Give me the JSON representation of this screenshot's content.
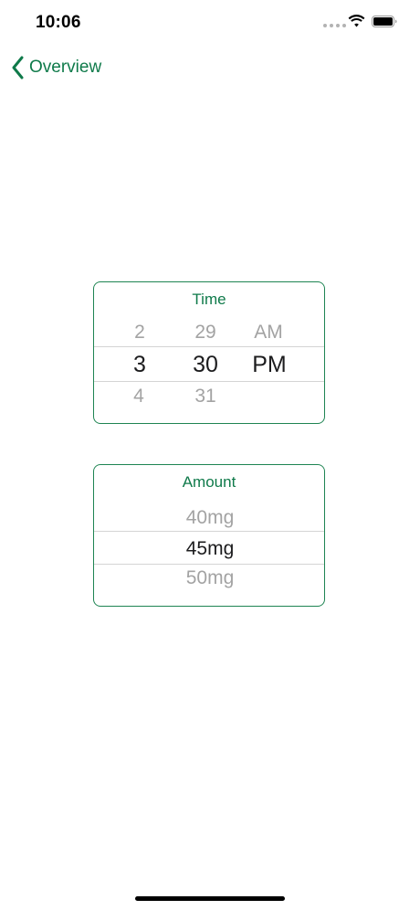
{
  "status_bar": {
    "time": "10:06"
  },
  "nav": {
    "back_label": "Overview",
    "back_icon": "chevron-left-icon"
  },
  "colors": {
    "accent": "#0f7a4a",
    "card_border": "#1e8452",
    "dimmed_text": "#a3a3a3"
  },
  "time_picker": {
    "title": "Time",
    "hours": {
      "above": "2",
      "selected": "3",
      "below": "4"
    },
    "minutes": {
      "above": "29",
      "selected": "30",
      "below": "31"
    },
    "period": {
      "above": "AM",
      "selected": "PM"
    }
  },
  "amount_picker": {
    "title": "Amount",
    "above": "40mg",
    "selected": "45mg",
    "below": "50mg"
  }
}
